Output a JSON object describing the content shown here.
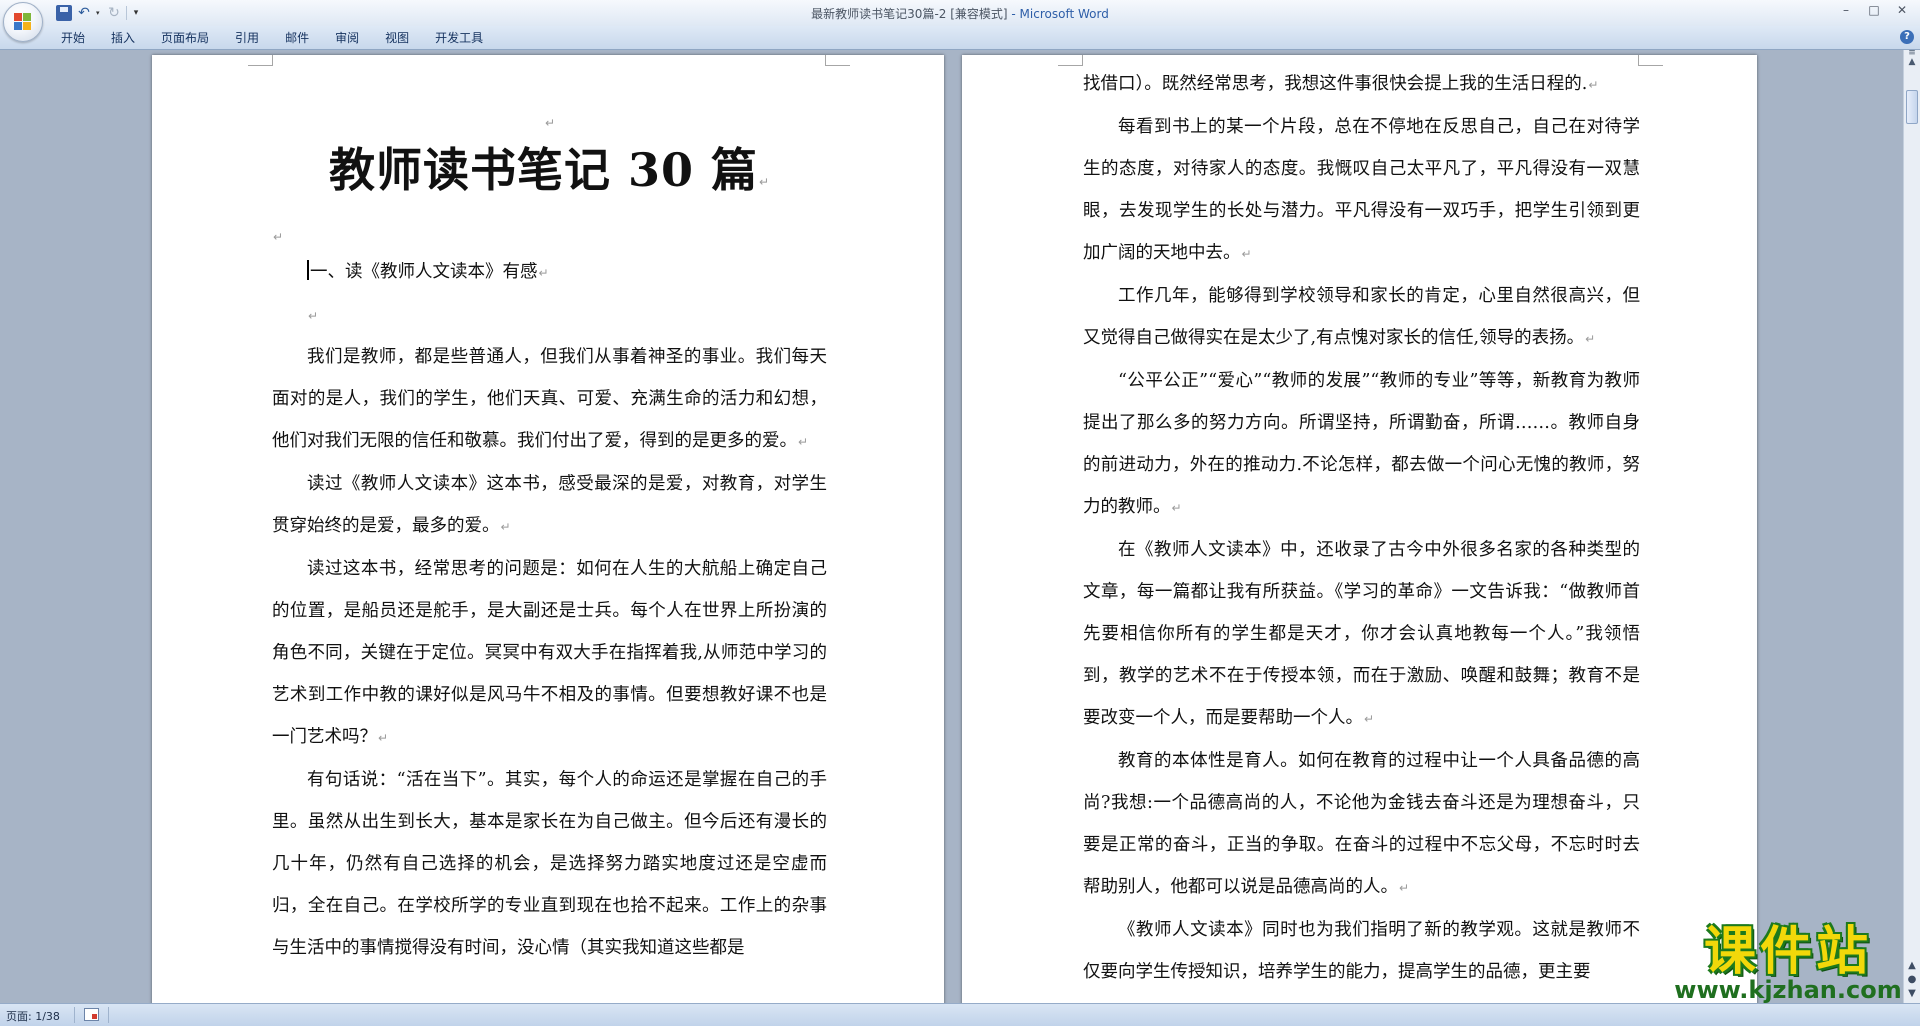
{
  "window": {
    "title": "最新教师读书笔记30篇-2 [兼容模式]",
    "app_name": " - Microsoft Word",
    "controls": [
      "–",
      "□",
      "✕"
    ]
  },
  "quick_access": {
    "more_label": "▾"
  },
  "ribbon": {
    "tabs": [
      "开始",
      "插入",
      "页面布局",
      "引用",
      "邮件",
      "审阅",
      "视图",
      "开发工具"
    ],
    "help_label": "?"
  },
  "document": {
    "left_page": {
      "heading": "教师读书笔记 30 篇",
      "section_heading": "一、读《教师人文读本》有感",
      "paragraphs": [
        "我们是教师，都是些普通人，但我们从事着神圣的事业。我们每天面对的是人，我们的学生，他们天真、可爱、充满生命的活力和幻想，他们对我们无限的信任和敬慕。我们付出了爱，得到的是更多的爱。",
        "读过《教师人文读本》这本书，感受最深的是爱，对教育，对学生贯穿始终的是爱，最多的爱。",
        "读过这本书，经常思考的问题是：如何在人生的大航船上确定自己的位置，是船员还是舵手，是大副还是士兵。每个人在世界上所扮演的角色不同，关键在于定位。冥冥中有双大手在指挥着我,从师范中学习的艺术到工作中教的课好似是风马牛不相及的事情。但要想教好课不也是一门艺术吗？",
        "有句话说：“活在当下”。其实，每个人的命运还是掌握在自己的手里。虽然从出生到长大，基本是家长在为自己做主。但今后还有漫长的几十年，仍然有自己选择的机会，是选择努力踏实地度过还是空虚而归，全在自己。在学校所学的专业直到现在也拾不起来。工作上的杂事与生活中的事情搅得没有时间，没心情（其实我知道这些都是"
      ]
    },
    "right_page": {
      "continuation": "找借口）。既然经常思考，我想这件事很快会提上我的生活日程的.",
      "paragraphs": [
        "每看到书上的某一个片段，总在不停地在反思自己，自己在对待学生的态度，对待家人的态度。我慨叹自己太平凡了，平凡得没有一双慧眼，去发现学生的长处与潜力。平凡得没有一双巧手，把学生引领到更加广阔的天地中去。",
        "工作几年，能够得到学校领导和家长的肯定，心里自然很高兴，但又觉得自己做得实在是太少了,有点愧对家长的信任,领导的表扬。",
        "“公平公正”“爱心”“教师的发展”“教师的专业”等等，新教育为教师提出了那么多的努力方向。所谓坚持，所谓勤奋，所谓……。教师自身的前进动力，外在的推动力.不论怎样，都去做一个问心无愧的教师，努力的教师。",
        "在《教师人文读本》中，还收录了古今中外很多名家的各种类型的文章，每一篇都让我有所获益。《学习的革命》一文告诉我：“做教师首先要相信你所有的学生都是天才，你才会认真地教每一个人。”我领悟到，教学的艺术不在于传授本领，而在于激励、唤醒和鼓舞；教育不是要改变一个人，而是要帮助一个人。",
        "教育的本体性是育人。如何在教育的过程中让一个人具备品德的高尚?我想:一个品德高尚的人，不论他为金钱去奋斗还是为理想奋斗，只要是正常的奋斗，正当的争取。在奋斗的过程中不忘父母，不忘时时去帮助别人，他都可以说是品德高尚的人。",
        "《教师人文读本》同时也为我们指明了新的教学观。这就是教师不仅要向学生传授知识，培养学生的能力，提高学生的品德，更主要"
      ]
    },
    "paragraph_mark": "↵"
  },
  "status": {
    "page": "页面: 1/38"
  },
  "watermark": {
    "name": "课件站",
    "url": "www.kjzhan.com"
  },
  "colors": {
    "title_app": "#2e5ea8",
    "ribbon_bg": "#c8d8ec",
    "workspace": "#a7b4c6",
    "watermark_yellow": "#f2d80a",
    "watermark_green": "#1d7a1d"
  }
}
